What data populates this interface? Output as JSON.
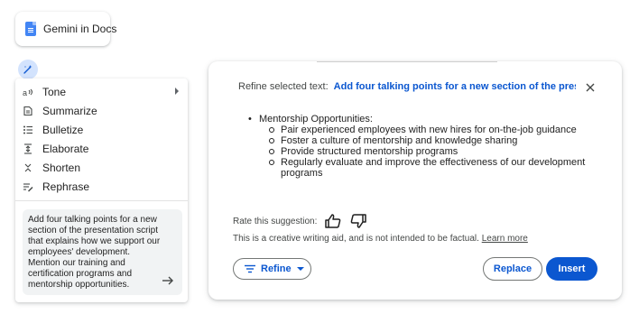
{
  "app_chip": {
    "label": "Gemini in Docs",
    "icon": "docs-icon",
    "icon_color": "#4285f4"
  },
  "sparkle_button": {
    "icon": "sparkle-pen-icon",
    "bg_color": "#d3e3fd"
  },
  "menu": {
    "items": [
      {
        "label": "Tone",
        "icon": "tone-icon",
        "has_submenu": true
      },
      {
        "label": "Summarize",
        "icon": "summarize-icon"
      },
      {
        "label": "Bulletize",
        "icon": "bulletize-icon"
      },
      {
        "label": "Elaborate",
        "icon": "elaborate-icon"
      },
      {
        "label": "Shorten",
        "icon": "shorten-icon"
      },
      {
        "label": "Rephrase",
        "icon": "rephrase-icon"
      }
    ],
    "prompt_text": "Add four talking points for a new section of the presentation script that explains how we support our employees' development. Mention our training and certification programs and mentorship opportunities.",
    "send_icon": "arrow-right-icon"
  },
  "result": {
    "header_prefix": "Refine selected text:",
    "header_highlight": "Add four talking points for a new section of the presentation sc",
    "heading_bullet": "Mentorship Opportunities:",
    "sub_bullets": [
      "Pair experienced employees with new hires for on-the-job guidance",
      "Foster a culture of mentorship and knowledge sharing",
      "Provide structured mentorship programs",
      "Regularly evaluate and improve the effectiveness of our development programs"
    ],
    "rate_label": "Rate this suggestion:",
    "disclaimer": "This is a creative writing aid, and is not intended to be factual.",
    "learn_more": "Learn more",
    "refine_label": "Refine",
    "replace_label": "Replace",
    "insert_label": "Insert",
    "accent_color": "#0b57d0"
  }
}
